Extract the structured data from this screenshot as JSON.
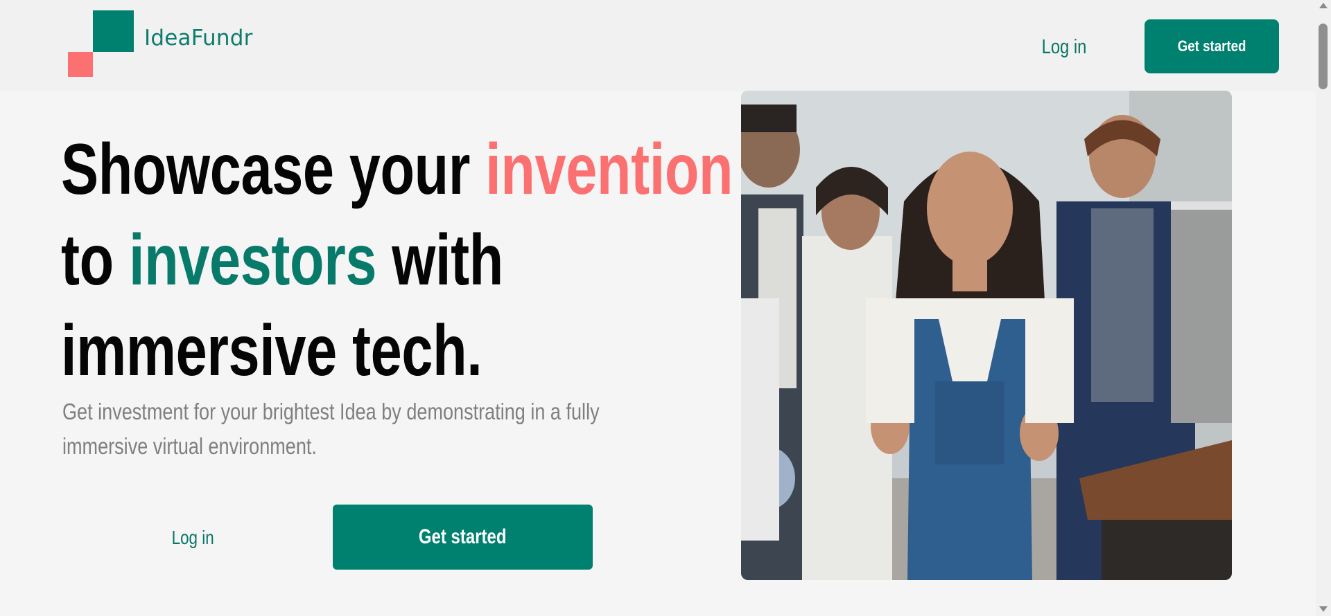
{
  "header": {
    "logo_text": "IdeaFundr",
    "nav_login_label": "Log in",
    "nav_cta_label": "Get started"
  },
  "hero": {
    "title_part1": "Showcase your ",
    "title_highlight1": "invention",
    "title_part2": "to ",
    "title_highlight2": "investors",
    "title_part3": " with",
    "title_part4": "immersive tech.",
    "subtitle": "Get investment for your brightest Idea by demonstrating in a fully immersive virtual environment.",
    "login_label": "Log in",
    "cta_label": "Get started"
  },
  "colors": {
    "brand_green": "#008170",
    "accent_coral": "#fb7070",
    "background": "#f5f5f5",
    "header_background": "#f1f1f1",
    "title_text": "#050505",
    "subtitle_text": "#7f7f7f"
  },
  "icons": {
    "logo": "logo-icon",
    "scroll_up": "scroll-up-arrow-icon",
    "scroll_down": "scroll-down-arrow-icon"
  }
}
